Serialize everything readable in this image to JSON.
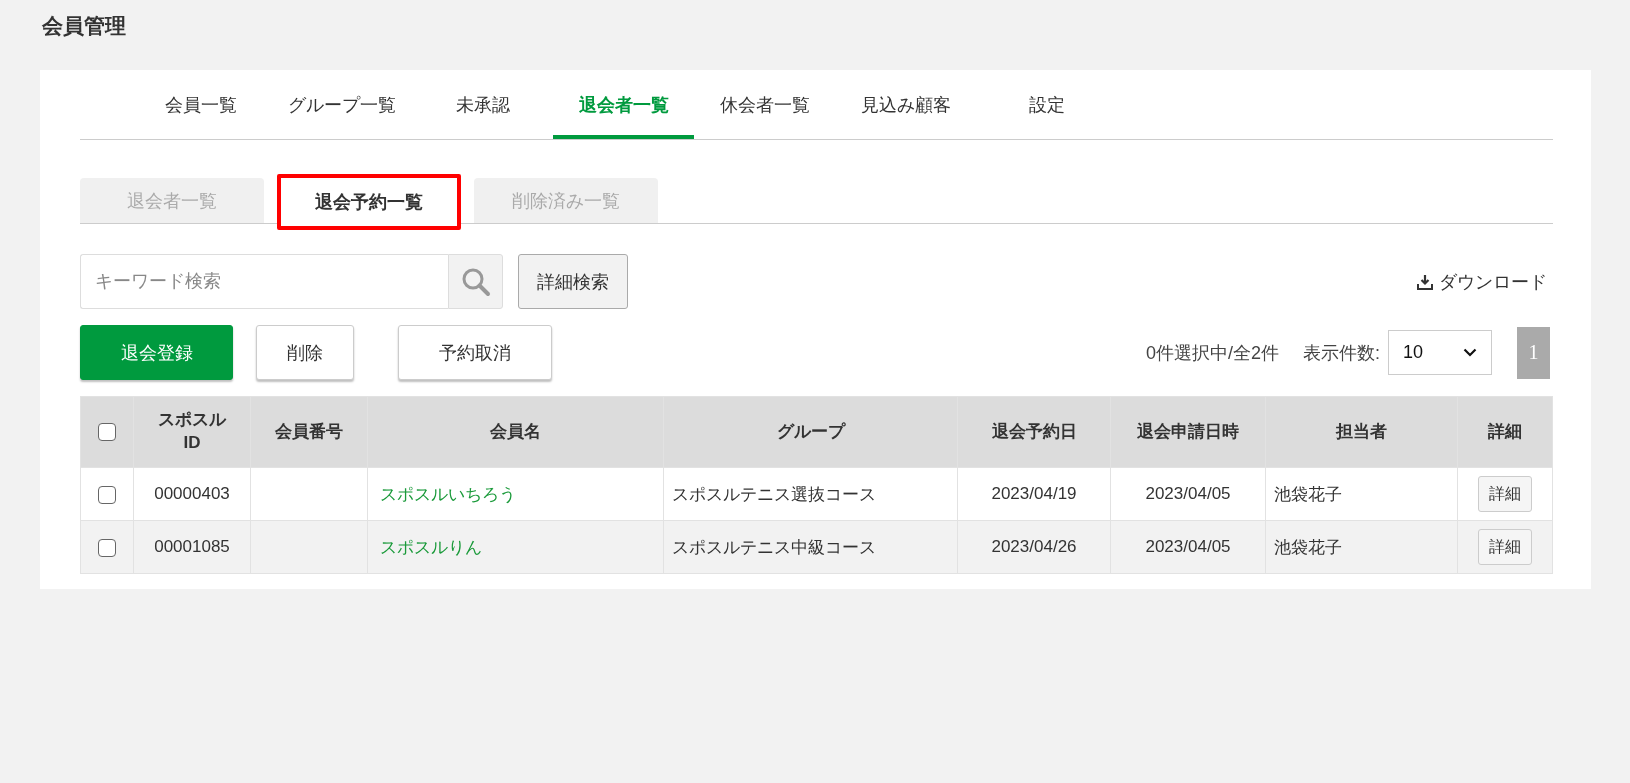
{
  "page_title": "会員管理",
  "main_tabs": [
    {
      "label": "会員一覧",
      "selected": false
    },
    {
      "label": "グループ一覧",
      "selected": false
    },
    {
      "label": "未承認",
      "selected": false
    },
    {
      "label": "退会者一覧",
      "selected": true
    },
    {
      "label": "休会者一覧",
      "selected": false
    },
    {
      "label": "見込み顧客",
      "selected": false
    },
    {
      "label": "設定",
      "selected": false
    }
  ],
  "sub_tabs": [
    {
      "label": "退会者一覧",
      "selected": false,
      "highlighted": false
    },
    {
      "label": "退会予約一覧",
      "selected": true,
      "highlighted": true
    },
    {
      "label": "削除済み一覧",
      "selected": false,
      "highlighted": false
    }
  ],
  "search": {
    "placeholder": "キーワード検索"
  },
  "advanced_search_button": "詳細検索",
  "download_link": "ダウンロード",
  "action_buttons": [
    {
      "label": "退会登録",
      "kind": "primary"
    },
    {
      "label": "削除",
      "kind": "plain"
    },
    {
      "label": "予約取消",
      "kind": "plain"
    }
  ],
  "selection_count": "0件選択中/全2件",
  "page_size": {
    "label": "表示件数:",
    "value": "10"
  },
  "pagination": [
    {
      "label": "1",
      "selected": true
    }
  ],
  "table": {
    "select_all_checked": false,
    "columns": [
      "スポスル\nID",
      "会員番号",
      "会員名",
      "グループ",
      "退会予約日",
      "退会申請日時",
      "担当者",
      "詳細"
    ],
    "rows": [
      {
        "checked": false,
        "id": "00000403",
        "name": "スポスルいちろう",
        "group": "スポスルテニス選抜コース",
        "reservation_date": "2023/04/19",
        "request_date": "2023/04/05",
        "staff": "池袋花子",
        "detail_button": "詳細"
      },
      {
        "checked": false,
        "id": "00001085",
        "name": "スポスルりん",
        "group": "スポスルテニス中級コース",
        "reservation_date": "2023/04/26",
        "request_date": "2023/04/05",
        "staff": "池袋花子",
        "detail_button": "詳細"
      }
    ]
  }
}
